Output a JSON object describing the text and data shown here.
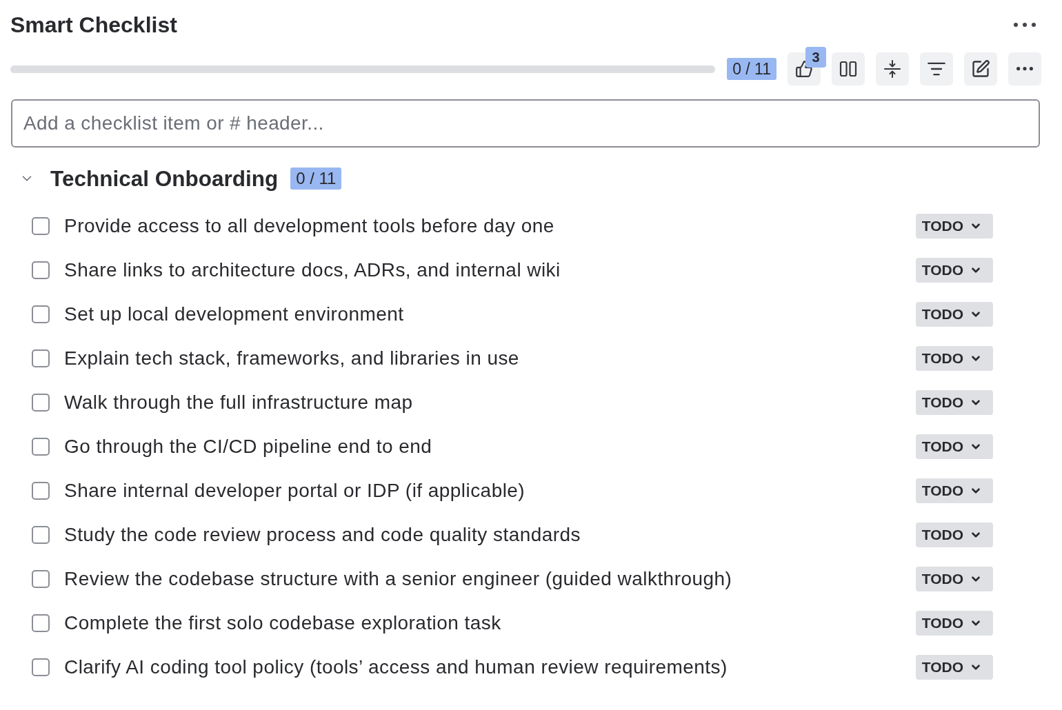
{
  "header": {
    "title": "Smart Checklist"
  },
  "progress": {
    "level": 0,
    "count": "0 / 11"
  },
  "toolbar": [
    {
      "kind": "vote",
      "badge": "3"
    },
    {
      "kind": "columns"
    },
    {
      "kind": "collapse"
    },
    {
      "kind": "filter"
    },
    {
      "kind": "edit"
    },
    {
      "kind": "more"
    }
  ],
  "new_item": {
    "placeholder": "Add a checklist item or # header..."
  },
  "sections": [
    {
      "title": "Technical Onboarding",
      "count": "0 / 11",
      "expanded": true,
      "items": [
        {
          "label": "Provide access to all development tools before day one",
          "checked": false,
          "status": "TODO"
        },
        {
          "label": "Share links to architecture docs, ADRs, and internal wiki",
          "checked": false,
          "status": "TODO"
        },
        {
          "label": "Set up local development environment",
          "checked": false,
          "status": "TODO"
        },
        {
          "label": "Explain tech stack, frameworks, and libraries in use",
          "checked": false,
          "status": "TODO"
        },
        {
          "label": "Walk through the full infrastructure map",
          "checked": false,
          "status": "TODO"
        },
        {
          "label": "Go through the CI/CD pipeline end to end",
          "checked": false,
          "status": "TODO"
        },
        {
          "label": "Share internal developer portal or IDP (if applicable)",
          "checked": false,
          "status": "TODO"
        },
        {
          "label": "Study the code review process and code quality standards",
          "checked": false,
          "status": "TODO"
        },
        {
          "label": "Review the codebase structure with a senior engineer (guided walkthrough)",
          "checked": false,
          "status": "TODO"
        },
        {
          "label": "Complete the first solo codebase exploration task",
          "checked": false,
          "status": "TODO"
        },
        {
          "label": "Clarify AI coding tool policy (tools’ access and human review requirements)",
          "checked": false,
          "status": "TODO"
        }
      ]
    }
  ]
}
